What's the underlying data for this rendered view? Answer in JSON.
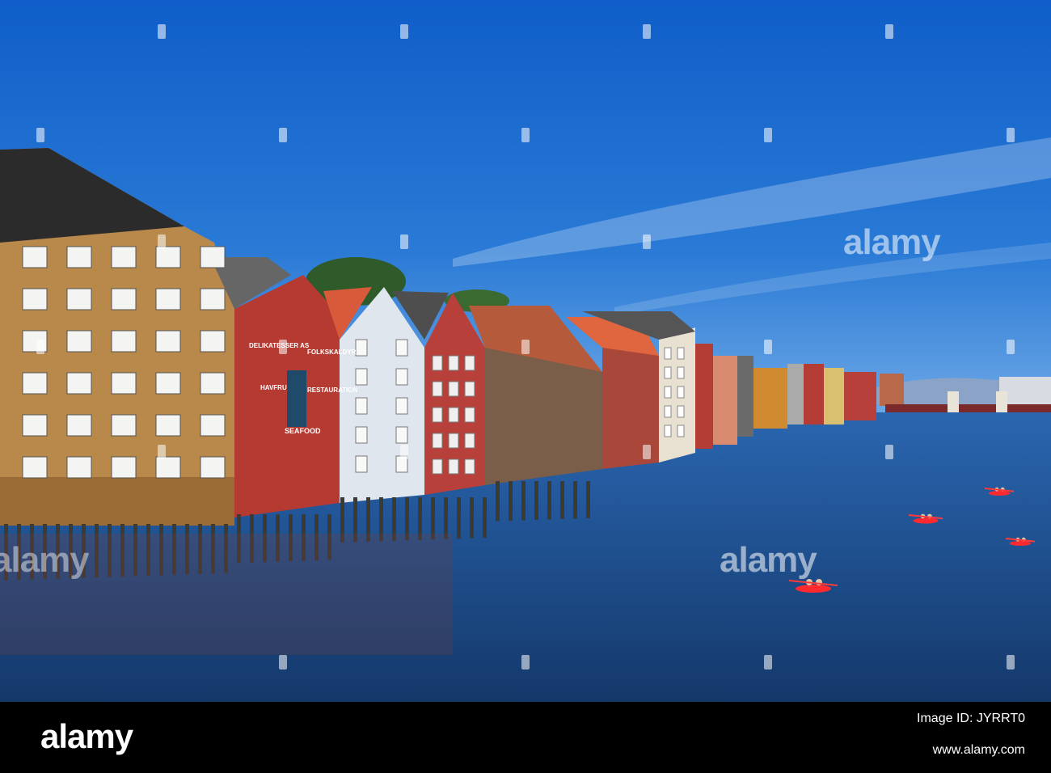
{
  "watermark": {
    "brand": "alamy",
    "image_id_label": "Image ID: JYRRT0",
    "site": "www.alamy.com"
  },
  "photo": {
    "sky_color": "#1f6fd0",
    "water_color": "#1f4f8a",
    "building_colors": [
      "#b8894a",
      "#b43a32",
      "#dfe6ee",
      "#b8403a",
      "#7a5e4a",
      "#b5513a",
      "#e8e0d0",
      "#d08a30"
    ],
    "kayak_color": "#ff2a30",
    "signage": {
      "deli": "DELIKATESSER AS",
      "folk": "FOLKSKALDYR",
      "havfruen": "HAVFRUEN",
      "restaurant": "RESTAURATION",
      "seafood": "SEAFOOD"
    }
  }
}
